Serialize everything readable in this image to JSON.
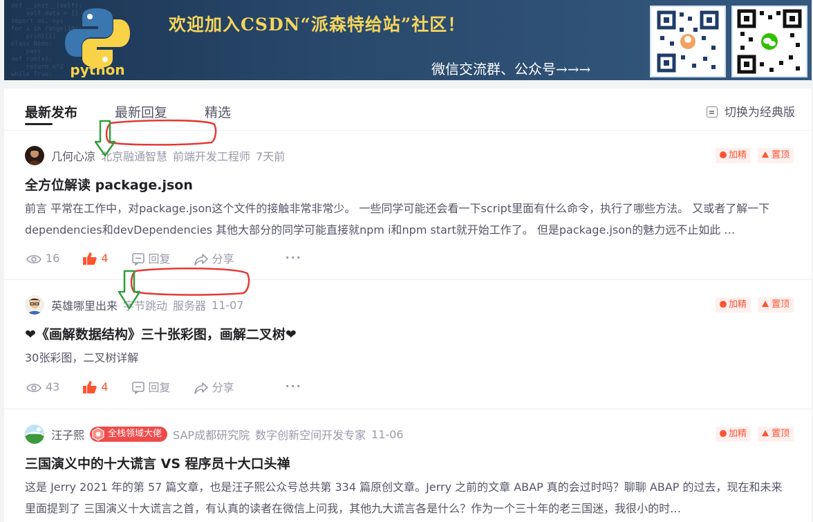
{
  "banner": {
    "title": "欢迎加入CSDN“派森特给站”社区！",
    "subtitle": "微信交流群、公众号→→→",
    "logo_text": "python",
    "icons": [
      "python-logo-icon",
      "qr-code-icon",
      "wechat-icon"
    ]
  },
  "tabs": {
    "items": [
      {
        "label": "最新发布"
      },
      {
        "label": "最新回复"
      },
      {
        "label": "精选"
      }
    ],
    "active": 0,
    "switch_label": "切换为经典版"
  },
  "posts": [
    {
      "author": "几何心凉",
      "company": "北京融通智慧",
      "position": "前端开发工程师",
      "time": "7天前",
      "tag_featured": "加精",
      "tag_pinned": "置顶",
      "title": "全方位解读 package.json",
      "desc": "前言 平常在工作中，对package.json这个文件的接触非常非常少。 一些同学可能还会看一下script里面有什么命令，执行了哪些方法。 又或者了解一下dependencies和devDependencies 其他大部分的同学可能直接就npm i和npm start就开始工作了。 但是package.json的魅力远不止如此 …",
      "views": "16",
      "likes": "4",
      "reply_label": "回复",
      "share_label": "分享"
    },
    {
      "author": "英雄哪里出来",
      "company": "字节跳动",
      "position": "服务器",
      "time": "11-07",
      "tag_featured": "加精",
      "tag_pinned": "置顶",
      "title": "❤《画解数据结构》三十张彩图，画解二叉树❤",
      "desc": "30张彩图，二叉树详解",
      "views": "43",
      "likes": "4",
      "reply_label": "回复",
      "share_label": "分享"
    },
    {
      "author": "汪子熙",
      "badge": "全栈领域大佬",
      "company": "SAP成都研究院",
      "position": "数字创新空间开发专家",
      "time": "11-06",
      "tag_featured": "加精",
      "tag_pinned": "置顶",
      "title": "三国演义中的十大谎言 VS 程序员十大口头禅",
      "desc": "这是 Jerry 2021 年的第 57 篇文章，也是汪子熙公众号总共第 334 篇原创文章。Jerry 之前的文章 ABAP 真的会过时吗？聊聊 ABAP 的过去，现在和未来 里面提到了 三国演义十大谎言之首，有认真的读者在微信上问我，其他九大谎言各是什么？作为一个三十年的老三国迷，我很小的时…"
    }
  ],
  "colors": {
    "accent": "#fc5531",
    "text": "#222226",
    "secondary": "#555666",
    "muted": "#999aaa",
    "annotation_red": "#e53935",
    "annotation_green": "#2e9e3a"
  }
}
